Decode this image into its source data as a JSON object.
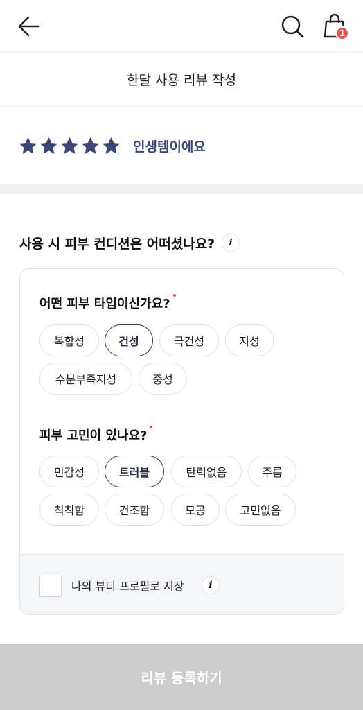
{
  "header": {
    "cart_count": "1",
    "title": "한달 사용 리뷰 작성"
  },
  "rating": {
    "value": 5,
    "max": 5,
    "label": "인생템이에요",
    "star_color": "#3b4674"
  },
  "question": {
    "title": "사용 시 피부 컨디션은 어떠셨나요?",
    "info": "i"
  },
  "skin_type": {
    "label": "어떤 피부 타입이신가요?",
    "options": [
      "복합성",
      "건성",
      "극건성",
      "지성",
      "수분부족지성",
      "중성"
    ],
    "selected": "건성"
  },
  "skin_concern": {
    "label": "피부 고민이 있나요?",
    "options": [
      "민감성",
      "트러블",
      "탄력없음",
      "주름",
      "칙칙함",
      "건조함",
      "모공",
      "고민없음"
    ],
    "selected": "트러블"
  },
  "save_profile": {
    "label": "나의 뷰티 프로필로 저장",
    "info": "i",
    "checked": false
  },
  "submit": {
    "label": "리뷰 등록하기"
  },
  "colors": {
    "accent": "#3b4674",
    "badge": "#f2504b",
    "submit_disabled": "#cccccc"
  }
}
